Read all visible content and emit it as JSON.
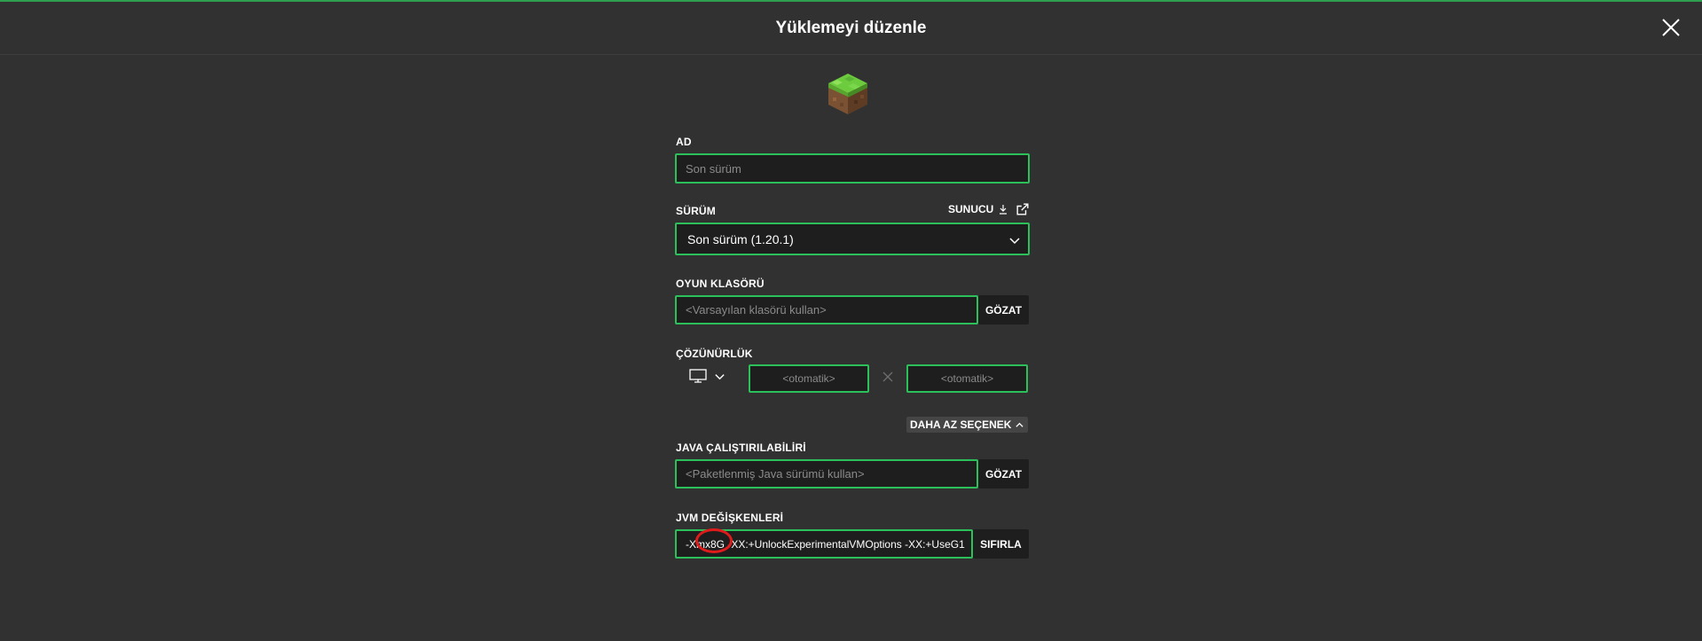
{
  "dialog": {
    "title": "Yüklemeyi düzenle",
    "close_icon": "close-icon"
  },
  "icon": {
    "name": "grass-block-icon"
  },
  "fields": {
    "name": {
      "label": "AD",
      "placeholder": "Son sürüm",
      "value": ""
    },
    "version": {
      "label": "SÜRÜM",
      "server_link_label": "SUNUCU",
      "selected": "Son sürüm (1.20.1)"
    },
    "game_dir": {
      "label": "OYUN KLASÖRÜ",
      "placeholder": "<Varsayılan klasörü kullan>",
      "browse_label": "GÖZAT"
    },
    "resolution": {
      "label": "ÇÖZÜNÜRLÜK",
      "width_placeholder": "<otomatik>",
      "height_placeholder": "<otomatik>"
    },
    "less_options_label": "DAHA AZ SEÇENEK",
    "java": {
      "label": "JAVA ÇALIŞTIRILABİLİRİ",
      "placeholder": "<Paketlenmiş Java sürümü kullan>",
      "browse_label": "GÖZAT"
    },
    "jvm": {
      "label": "JVM DEĞİŞKENLERİ",
      "value": "-Xmx8G -XX:+UnlockExperimentalVMOptions -XX:+UseG1",
      "reset_label": "SIFIRLA"
    }
  },
  "colors": {
    "background": "#313131",
    "input_bg": "#1e1e1e",
    "accent_green": "#2cc05a",
    "annotation_red": "#e01b1b"
  }
}
